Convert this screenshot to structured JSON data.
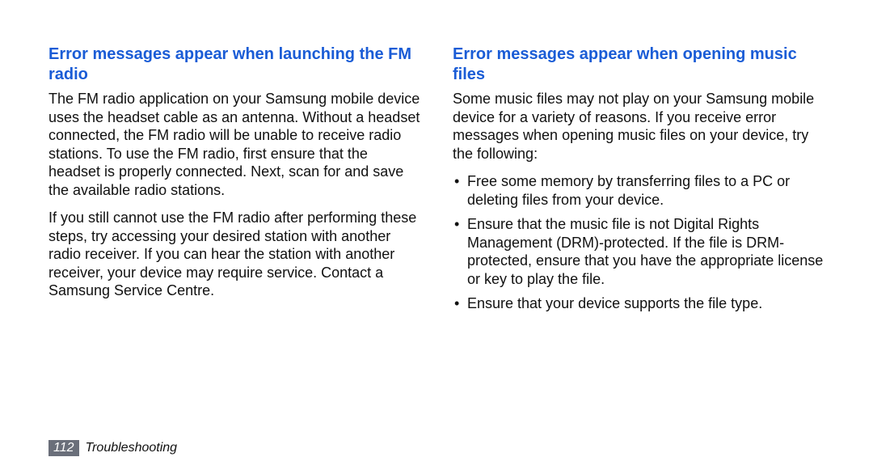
{
  "left": {
    "heading": "Error messages appear when launching the FM radio",
    "p1": "The FM radio application on your Samsung mobile device uses the headset cable as an antenna. Without a headset connected, the FM radio will be unable to receive radio stations. To use the FM radio, first ensure that the headset is properly connected. Next, scan for and save the available radio stations.",
    "p2": "If you still cannot use the FM radio after performing these steps, try accessing your desired station with another radio receiver. If you can hear the station with another receiver, your device may require service. Contact a Samsung Service Centre."
  },
  "right": {
    "heading": "Error messages appear when opening music files",
    "intro": "Some music files may not play on your Samsung mobile device for a variety of reasons. If you receive error messages when opening music files on your device, try the following:",
    "bullets": [
      "Free some memory by transferring files to a PC or deleting files from your device.",
      "Ensure that the music file is not Digital Rights Management (DRM)-protected. If the file is DRM-protected, ensure that you have the appropriate license or key to play the file.",
      "Ensure that your device supports the file type."
    ]
  },
  "footer": {
    "page_number": "112",
    "section": "Troubleshooting"
  }
}
